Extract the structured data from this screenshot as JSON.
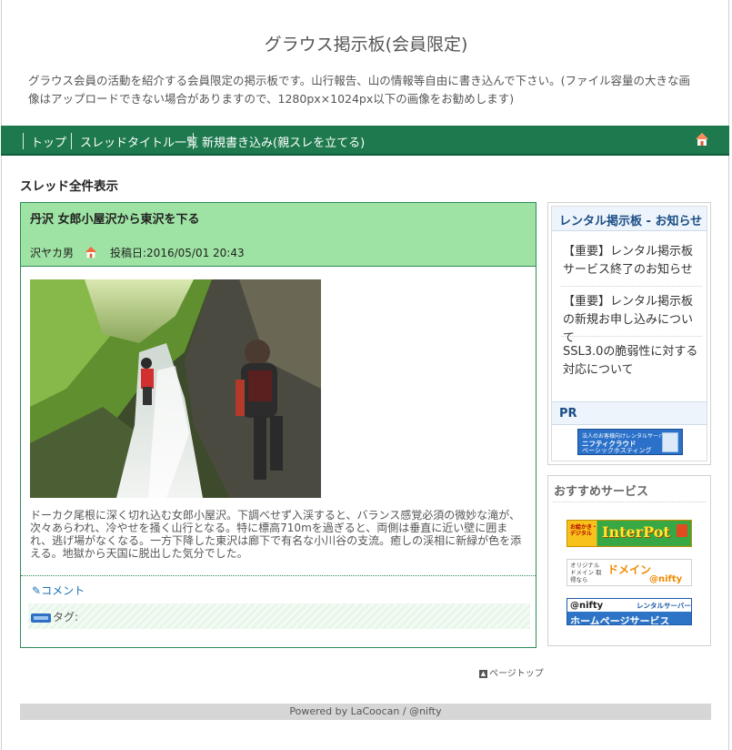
{
  "site": {
    "title": "グラウス掲示板(会員限定)",
    "description": "グラウス会員の活動を紹介する会員限定の掲示板です。山行報告、山の情報等自由に書き込んで下さい。(ファイル容量の大きな画像はアップロードできない場合がありますので、1280px×1024px以下の画像をお勧めします)"
  },
  "nav": {
    "top": "トップ",
    "thread_list": "スレッドタイトル一覧",
    "new_post": "新規書き込み(親スレを立てる)",
    "home_icon": "home-icon"
  },
  "section_title": "スレッド全件表示",
  "post": {
    "title": "丹沢 女郎小屋沢から東沢を下る",
    "author": "沢ヤカ男",
    "date": "投稿日:2016/05/01 20:43",
    "body": "ドーカク尾根に深く切れ込む女郎小屋沢。下調べせず入渓すると、バランス感覚必須の微妙な滝が、次々あらわれ、冷やせを掻く山行となる。特に標高710mを過ぎると、両側は垂直に近い壁に囲まれ、逃げ場がなくなる。一方下降した東沢は廊下で有名な小川谷の支流。癒しの渓相に新緑が色を添える。地獄から天国に脱出した気分でした。",
    "comment": "コメント",
    "tag_label": "タグ:"
  },
  "pagetop": "ページトップ",
  "footer": "Powered by LaCoocan / @nifty",
  "sidebar": {
    "news_title": "レンタル掲示板 - お知らせ",
    "news_items": [
      "【重要】レンタル掲示板サービス終了のお知らせ",
      "【重要】レンタル掲示板の新規お申し込みについて",
      "SSL3.0の脆弱性に対する対応について"
    ],
    "pr_title": "PR",
    "pr_banner": {
      "line1": "法人のお客様向けレンタルサーバー",
      "line2": "ニフティクラウド",
      "line3": "ベーシックホスティング"
    },
    "recommend_title": "おすすめサービス",
    "ads": {
      "interpot": {
        "small": "お絵かき・デジタル",
        "main": "InterPot"
      },
      "domain": {
        "left": "オリジナル ドメイン 取得なら",
        "main": "ドメイン",
        "sub": "@nifty"
      },
      "homepage": {
        "brand": "@nifty",
        "tag": "レンタルサーバー",
        "main": "ホームページサービス"
      }
    }
  },
  "colors": {
    "nav_green": "#1e7a4e",
    "post_header_green": "#9ee3a3",
    "sidebar_heading_blue": "#1a4d85"
  }
}
